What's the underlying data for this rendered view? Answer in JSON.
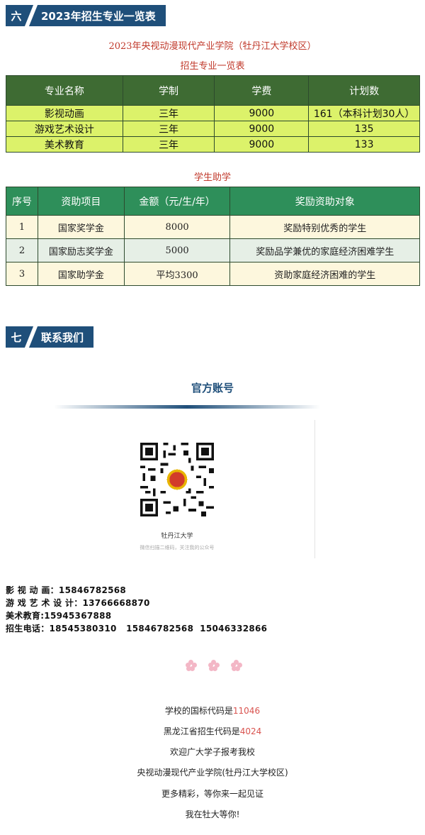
{
  "section6": {
    "num": "六",
    "title": "2023年招生专业一览表"
  },
  "school_title": "2023年央视动漫现代产业学院（牡丹江大学校区）",
  "majors_title": "招生专业一览表",
  "majors": {
    "headers": [
      "专业名称",
      "学制",
      "学费",
      "计划数"
    ],
    "rows": [
      [
        "影视动画",
        "三年",
        "9000",
        "161（本科计划30人）"
      ],
      [
        "游戏艺术设计",
        "三年",
        "9000",
        "135"
      ],
      [
        "美术教育",
        "三年",
        "9000",
        "133"
      ]
    ]
  },
  "aid_title": "学生助学",
  "aid": {
    "headers": [
      "序号",
      "资助项目",
      "金额（元/生/年）",
      "奖励资助对象"
    ],
    "rows": [
      [
        "1",
        "国家奖学金",
        "8000",
        "奖励特别优秀的学生"
      ],
      [
        "2",
        "国家励志奖学金",
        "5000",
        "奖励品学兼优的家庭经济困难学生"
      ],
      [
        "3",
        "国家助学金",
        "平均3300",
        "资助家庭经济困难的学生"
      ]
    ]
  },
  "section7": {
    "num": "七",
    "title": "联系我们"
  },
  "official": {
    "title": "官方账号",
    "qr_name": "牡丹江大学",
    "qr_hint": "微信扫描二维码，关注我的公众号"
  },
  "contacts": [
    "影 视 动 画：15846782568",
    "游 戏 艺 术 设 计：13766668870",
    "美术教育:15945367888",
    "招生电话：18545380310   15846782568  15046332866"
  ],
  "footer": {
    "line1_prefix": "学校的国标代码是",
    "line1_code": "11046",
    "line2_prefix": "黑龙江省招生代码是",
    "line2_code": "4024",
    "line3": "欢迎广大学子报考我校",
    "line4": "央视动漫现代产业学院(牡丹江大学校区)",
    "line5": "更多精彩，等你来一起见证",
    "line6": "我在牡大等你!"
  },
  "colors": {
    "header_blue": "#1f4f7a",
    "majors_header": "#3e6b33",
    "majors_row": "#dcf26a",
    "aid_header": "#2e8f5a",
    "highlight_red": "#d9534f"
  }
}
